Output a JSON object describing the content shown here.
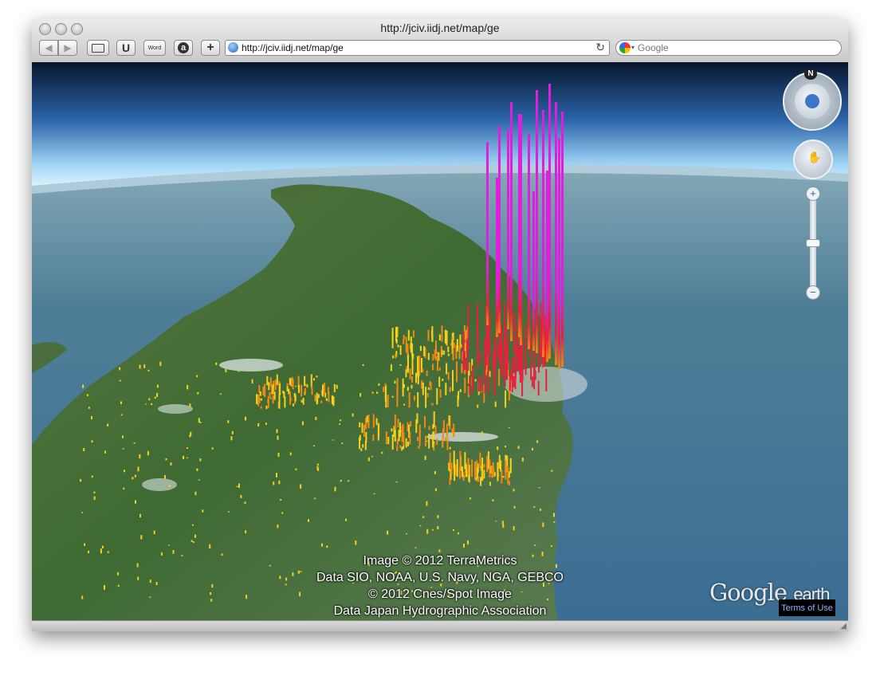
{
  "window": {
    "title": "http://jciv.iidj.net/map/ge"
  },
  "toolbar": {
    "u_label": "U",
    "word_label": "Word",
    "add_label": "+",
    "url_value": "http://jciv.iidj.net/map/ge",
    "search_placeholder": "Google"
  },
  "map": {
    "credits": [
      "Image © 2012 TerraMetrics",
      "Data SIO, NOAA, U.S. Navy, NGA, GEBCO",
      "© 2012 Cnes/Spot Image",
      "Data Japan Hydrographic Association"
    ],
    "logo_google": "Google",
    "logo_earth": "earth",
    "terms_label": "Terms of Use",
    "compass_north": "N"
  },
  "icons": {
    "back": "triangle-left",
    "forward": "triangle-right",
    "bookmarks": "book-icon",
    "amazon": "a-circle",
    "reload": "circular-arrow",
    "look": "eye",
    "move": "hand"
  },
  "colors": {
    "ocean": "#3f6f95",
    "land": "#3f6b35",
    "sky_top": "#0c1d3a",
    "bar_low": "#f4d21a",
    "bar_mid": "#f08a14",
    "bar_high": "#e8203c",
    "bar_peak": "#e01fdc"
  }
}
